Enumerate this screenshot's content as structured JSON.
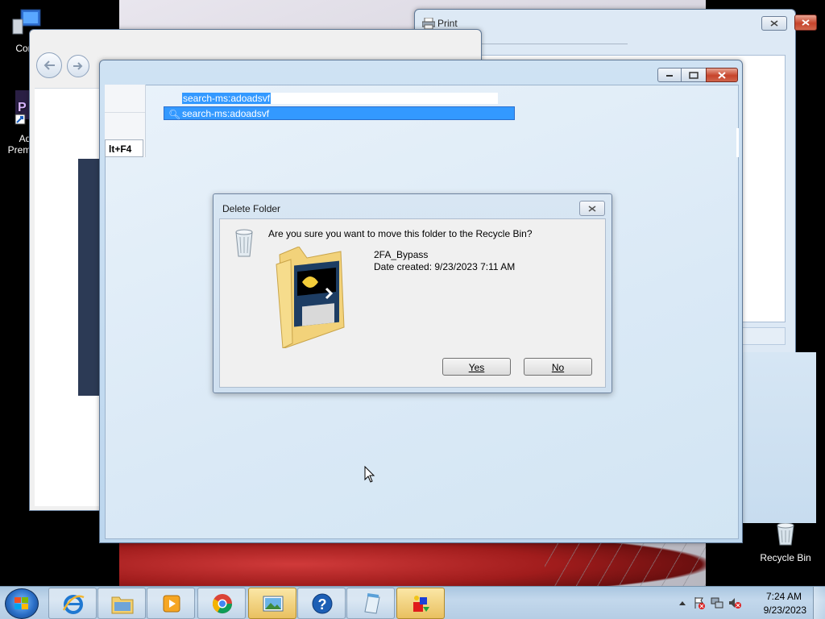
{
  "desktop": {
    "icons": [
      {
        "label": "Com"
      },
      {
        "label": "Ad"
      },
      {
        "label": "Prem"
      },
      {
        "label": "Recycle Bin"
      }
    ]
  },
  "print_window": {
    "title": "Print"
  },
  "main_window": {
    "menu_shortcut": "lt+F4",
    "search_value": "search-ms:adoadsvf",
    "search_suggestion": "search-ms:adoadsvf"
  },
  "delete_dialog": {
    "title": "Delete Folder",
    "question": "Are you sure you want to move this folder to the Recycle Bin?",
    "folder_name": "2FA_Bypass",
    "date_created": "Date created: 9/23/2023 7:11 AM",
    "yes_label": "Yes",
    "no_label": "No"
  },
  "taskbar": {
    "items": [
      {
        "name": "internet-explorer-icon"
      },
      {
        "name": "windows-explorer-icon"
      },
      {
        "name": "media-player-icon"
      },
      {
        "name": "chrome-icon"
      },
      {
        "name": "photo-viewer-icon"
      },
      {
        "name": "help-icon"
      },
      {
        "name": "notepad-icon"
      },
      {
        "name": "paint-3d-icon"
      }
    ],
    "clock_time": "7:24 AM",
    "clock_date": "9/23/2023"
  },
  "colors": {
    "selection": "#3399ff",
    "taskbar": "#b5cde4",
    "close_button": "#c7442b"
  }
}
